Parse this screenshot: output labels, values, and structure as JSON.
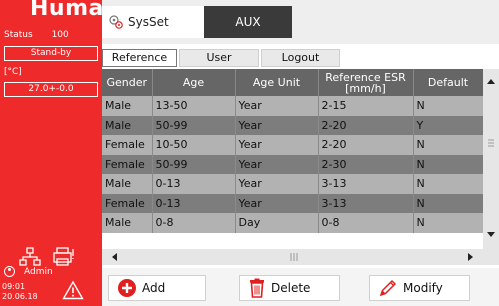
{
  "sidebar": {
    "brand": "Human",
    "status_label": "Status",
    "status_number": "100",
    "state": "Stand-by",
    "unit": "[°C]",
    "temperature": "27.0+-0.0",
    "user": "Admin",
    "time": "09:01",
    "date": "20.06.18",
    "icons": [
      "network-icon",
      "printer-icon",
      "user-icon",
      "warning-icon"
    ]
  },
  "tabs": {
    "sysset": "SysSet",
    "aux": "AUX"
  },
  "subtabs": [
    "Reference",
    "User",
    "Logout"
  ],
  "table": {
    "headers": [
      "Gender",
      "Age",
      "Age Unit",
      "Reference ESR [mm/h]",
      "Default"
    ],
    "header_esr_line1": "Reference ESR",
    "header_esr_line2": "[mm/h]",
    "rows": [
      [
        "Male",
        "13-50",
        "Year",
        "2-15",
        "N"
      ],
      [
        "Male",
        "50-99",
        "Year",
        "2-20",
        "Y"
      ],
      [
        "Female",
        "10-50",
        "Year",
        "2-20",
        "N"
      ],
      [
        "Female",
        "50-99",
        "Year",
        "2-30",
        "N"
      ],
      [
        "Male",
        "0-13",
        "Year",
        "3-13",
        "N"
      ],
      [
        "Female",
        "0-13",
        "Year",
        "3-13",
        "N"
      ],
      [
        "Male",
        "0-8",
        "Day",
        "0-8",
        "N"
      ]
    ]
  },
  "actions": {
    "add": "Add",
    "delete": "Delete",
    "modify": "Modify"
  },
  "colors": {
    "sidebar": "#ee2a2a",
    "header_dark": "#3a3a3a",
    "row_light": "#b2b2b2",
    "row_dark": "#7d7d7d",
    "table_header": "#666666"
  }
}
